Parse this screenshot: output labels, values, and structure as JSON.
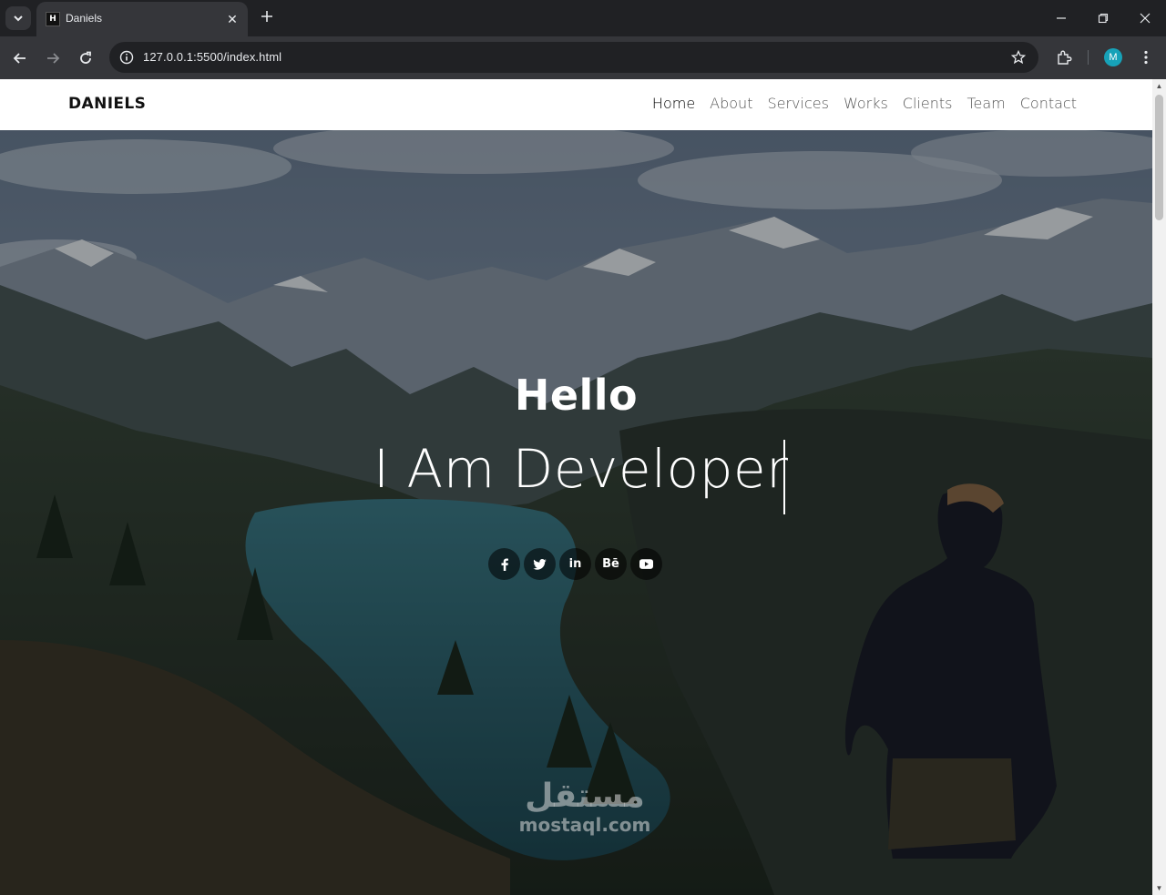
{
  "browser": {
    "tab_title": "Daniels",
    "favicon_text": "H",
    "url": "127.0.0.1:5500/index.html",
    "profile_initial": "M",
    "icons": [
      "tab-list-icon",
      "close-icon",
      "plus-icon",
      "minimize-icon",
      "restore-icon",
      "window-close-icon",
      "back-arrow-icon",
      "forward-arrow-icon",
      "reload-icon",
      "site-info-icon",
      "star-icon",
      "extensions-icon",
      "more-menu-icon"
    ]
  },
  "site": {
    "logo": "DANIELS",
    "nav": [
      "Home",
      "About",
      "Services",
      "Works",
      "Clients",
      "Team",
      "Contact"
    ],
    "active_nav": "Home"
  },
  "hero": {
    "greeting": "Hello",
    "tagline": "I Am Developer",
    "socials": [
      {
        "icon": "facebook-icon",
        "glyph": "f"
      },
      {
        "icon": "twitter-icon",
        "glyph": ""
      },
      {
        "icon": "linkedin-icon",
        "glyph": "in"
      },
      {
        "icon": "behance-icon",
        "glyph": "Bē"
      },
      {
        "icon": "youtube-icon",
        "glyph": ""
      }
    ]
  },
  "watermark": {
    "arabic": "مستقل",
    "latin": "mostaql.com"
  },
  "colors": {
    "chrome_dark": "#202124",
    "chrome_toolbar": "#35363a",
    "profile": "#17a2b8",
    "header_bg": "#ffffff"
  }
}
